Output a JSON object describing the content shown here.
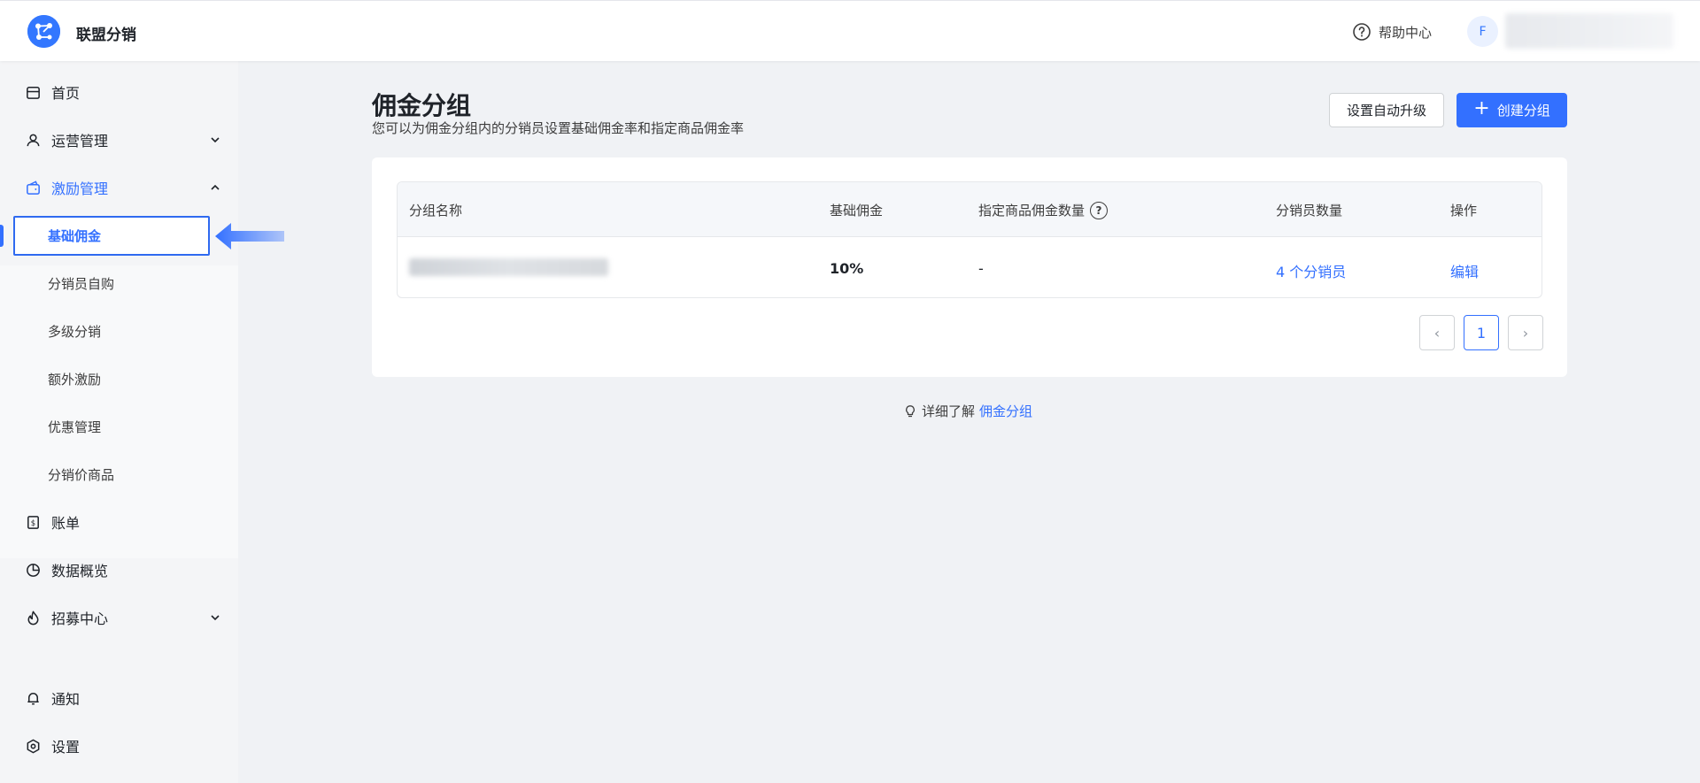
{
  "app": {
    "name": "联盟分销"
  },
  "header": {
    "help_label": "帮助中心",
    "avatar_letter": "F"
  },
  "sidebar": {
    "items": [
      {
        "label": "首页",
        "icon": "store-icon"
      },
      {
        "label": "运营管理",
        "icon": "user-icon",
        "expanded": false
      },
      {
        "label": "激励管理",
        "icon": "wallet-icon",
        "expanded": true
      },
      {
        "label": "账单",
        "icon": "bill-icon"
      },
      {
        "label": "数据概览",
        "icon": "pie-chart-icon"
      },
      {
        "label": "招募中心",
        "icon": "fire-icon",
        "expanded": false
      },
      {
        "label": "通知",
        "icon": "bell-icon"
      },
      {
        "label": "设置",
        "icon": "settings-icon"
      }
    ],
    "submenu": [
      {
        "label": "基础佣金",
        "active": true
      },
      {
        "label": "分销员自购"
      },
      {
        "label": "多级分销"
      },
      {
        "label": "额外激励"
      },
      {
        "label": "优惠管理"
      },
      {
        "label": "分销价商品"
      }
    ]
  },
  "page": {
    "title": "佣金分组",
    "description": "您可以为佣金分组内的分销员设置基础佣金率和指定商品佣金率",
    "auto_upgrade_button": "设置自动升级",
    "create_button": "创建分组"
  },
  "table": {
    "headers": [
      "分组名称",
      "基础佣金",
      "指定商品佣金数量",
      "分销员数量",
      "操作"
    ],
    "help_glyph": "?",
    "rows": [
      {
        "name": "",
        "base_commission": "10%",
        "specified_count": "-",
        "distributors": "4 个分销员",
        "action": "编辑"
      }
    ]
  },
  "pagination": {
    "prev": "‹",
    "current": "1",
    "next": "›"
  },
  "learn_more": {
    "prefix": "详细了解",
    "link": "佣金分组"
  },
  "colors": {
    "primary": "#3370ff",
    "sidebar_bg": "#f4f5f7",
    "page_bg": "#f0f2f5"
  }
}
